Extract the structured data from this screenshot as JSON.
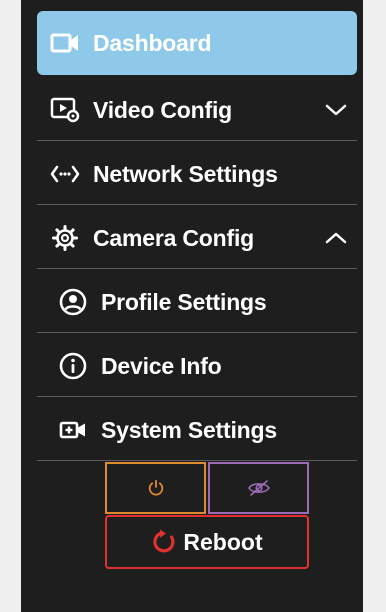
{
  "sidebar": {
    "items": [
      {
        "label": "Dashboard",
        "icon": "video-camera-icon",
        "active": true
      },
      {
        "label": "Video Config",
        "icon": "video-settings-icon",
        "expandable": true,
        "expanded": false
      },
      {
        "label": "Network Settings",
        "icon": "code-arrows-icon"
      },
      {
        "label": "Camera Config",
        "icon": "gear-icon",
        "expandable": true,
        "expanded": true
      },
      {
        "label": "Profile Settings",
        "icon": "user-circle-icon"
      },
      {
        "label": "Device Info",
        "icon": "info-circle-icon"
      },
      {
        "label": "System Settings",
        "icon": "camera-plus-icon"
      }
    ],
    "power_icon": "power-icon",
    "hide_icon": "eye-off-icon",
    "reboot_label": "Reboot",
    "reboot_icon": "refresh-icon"
  },
  "colors": {
    "sidebar_bg": "#1e1e1e",
    "active_bg": "#8ec9ea",
    "divider": "#5a5a5a",
    "power_border": "#e08a30",
    "hide_border": "#9b6bb5",
    "reboot_border": "#e0312f",
    "reboot_icon": "#e0312f"
  }
}
